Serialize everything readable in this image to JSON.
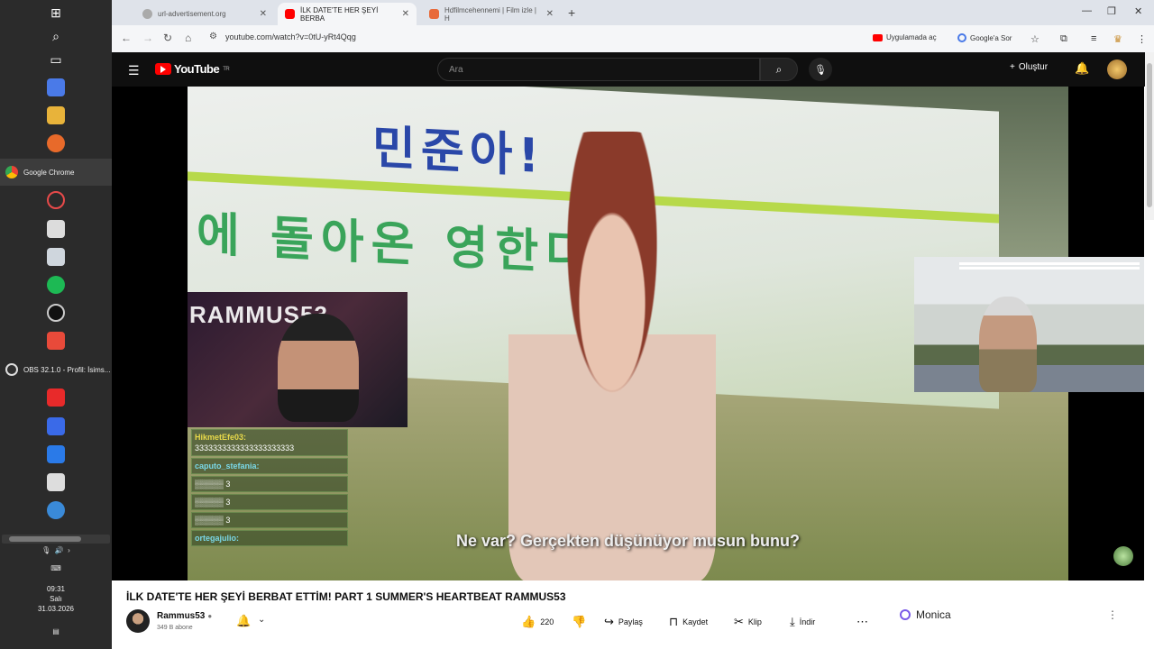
{
  "taskbar": {
    "apps": [
      {
        "label": "Google Chrome",
        "color": "#ea4335"
      },
      {
        "label": "OBS 32.1.0 - Profil: İsims...",
        "color": "#303030"
      }
    ],
    "clock": {
      "time": "09:31",
      "day": "Salı",
      "date": "31.03.2026"
    }
  },
  "browser": {
    "tabs": [
      {
        "label": "url-advertisement.org",
        "active": false
      },
      {
        "label": "İLK DATE'TE HER ŞEYİ BERBA",
        "active": true
      },
      {
        "label": "Hdfilmcehennemi | Film izle | H",
        "active": false
      }
    ],
    "url": "youtube.com/watch?v=0tU-yRt4Qqg",
    "open_in_app": "Uygulamada aç",
    "ask_google": "Google'a Sor"
  },
  "youtube": {
    "logo": "YouTube",
    "region": "TR",
    "search_placeholder": "Ara",
    "create_label": "Oluştur",
    "video": {
      "banner_line1": "민준아!",
      "banner_line2": "에 돌아온 영한다",
      "cam_brand": "RAMMUS53",
      "subtitle": "Ne var? Gerçekten düşünüyor musun bunu?",
      "chat": [
        {
          "user": "HikmetEfe03:",
          "text": "3333333333333333333333"
        },
        {
          "user": "caputo_stefania:",
          "text": ""
        },
        {
          "user": "",
          "text": "3"
        },
        {
          "user": "",
          "text": "3"
        },
        {
          "user": "",
          "text": "3"
        },
        {
          "user": "ortegajulio:",
          "text": ""
        }
      ]
    },
    "title": "İLK DATE'TE HER ŞEYİ BERBAT ETTİM! PART 1 SUMMER'S HEARTBEAT RAMMUS53",
    "channel": {
      "name": "Rammus53",
      "subscribers": "349 B abone"
    },
    "actions": {
      "likes": "220",
      "share": "Paylaş",
      "save": "Kaydet",
      "clip": "Klip",
      "download": "İndir"
    },
    "sidebar_panel": "Monica"
  }
}
